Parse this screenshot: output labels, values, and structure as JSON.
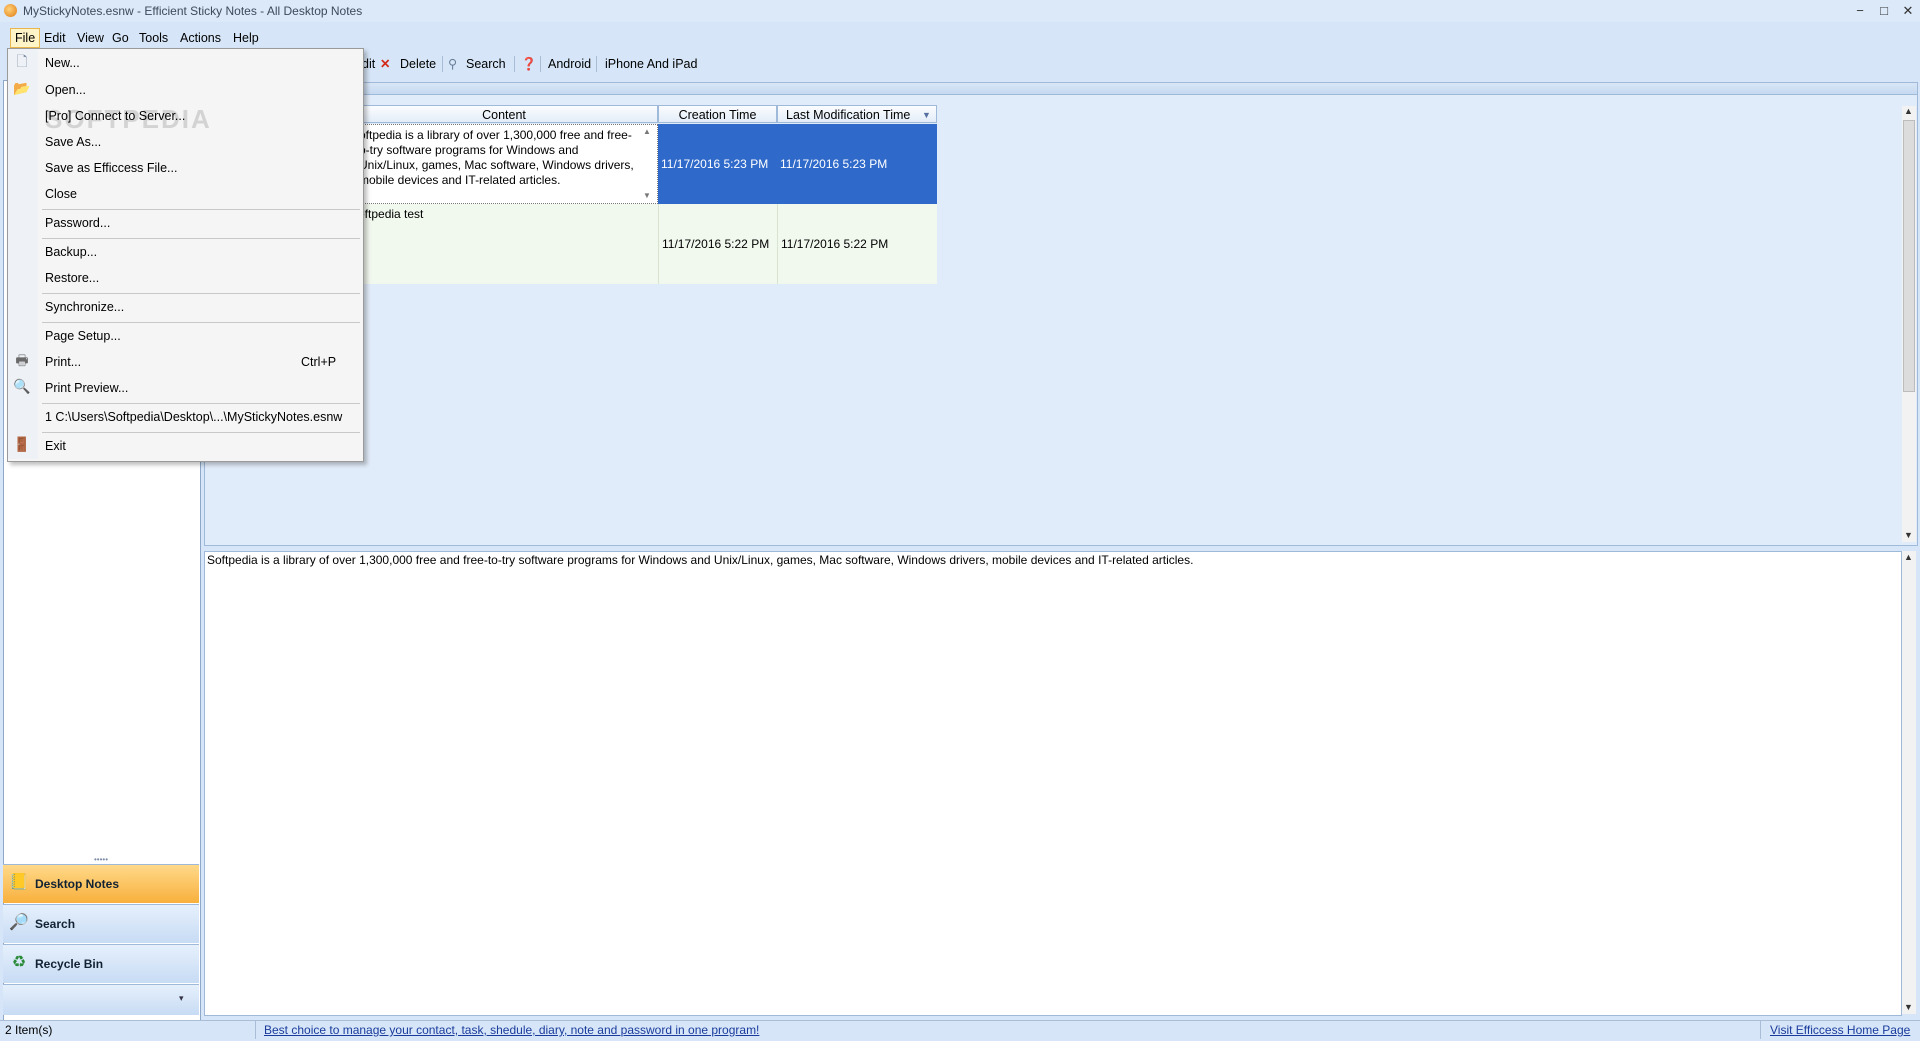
{
  "window": {
    "title": "MyStickyNotes.esnw - Efficient Sticky Notes - All Desktop Notes",
    "minimize": "−",
    "maximize": "□",
    "close": "✕"
  },
  "menubar": [
    "File",
    "Edit",
    "View",
    "Go",
    "Tools",
    "Actions",
    "Help"
  ],
  "toolbar": {
    "edit_partial": "dit",
    "delete": "Delete",
    "search": "Search",
    "android": "Android",
    "iphone": "iPhone And iPad"
  },
  "file_menu": {
    "items": [
      "New...",
      "Open...",
      "[Pro] Connect to Server...",
      "Save As...",
      "Save as Efficcess File...",
      "Close",
      "Password...",
      "Backup...",
      "Restore...",
      "Synchronize...",
      "Page Setup...",
      "Print...",
      "Print Preview...",
      "1 C:\\Users\\Softpedia\\Desktop\\...\\MyStickyNotes.esnw",
      "Exit"
    ],
    "print_shortcut": "Ctrl+P"
  },
  "grid": {
    "columns": [
      "Content",
      "Creation Time",
      "Last Modification Time"
    ],
    "rows": [
      {
        "content_lines": [
          "oftpedia is a library of over 1,300,000 free and free-",
          "o-try software programs for Windows and",
          "Unix/Linux, games, Mac software, Windows drivers,",
          "mobile devices and IT-related articles."
        ],
        "created": "11/17/2016 5:23 PM",
        "modified": "11/17/2016 5:23 PM"
      },
      {
        "content_lines": [
          "oftpedia test"
        ],
        "created": "11/17/2016 5:22 PM",
        "modified": "11/17/2016 5:22 PM"
      }
    ]
  },
  "preview_text": "Softpedia is a library of over 1,300,000 free and free-to-try software programs for Windows and Unix/Linux, games, Mac software, Windows drivers, mobile devices and IT-related articles.",
  "nav": {
    "desktop_notes": "Desktop Notes",
    "search": "Search",
    "recycle_bin": "Recycle Bin"
  },
  "status": {
    "count": "2 Item(s)",
    "promo": "Best choice to manage your contact, task, shedule, diary, note and password in one program!",
    "home_link": "Visit Efficcess Home Page"
  },
  "watermark": "SOFTPEDIA",
  "colors": {
    "selected_row": "#2f69c9",
    "active_nav": "#f8b03c"
  }
}
